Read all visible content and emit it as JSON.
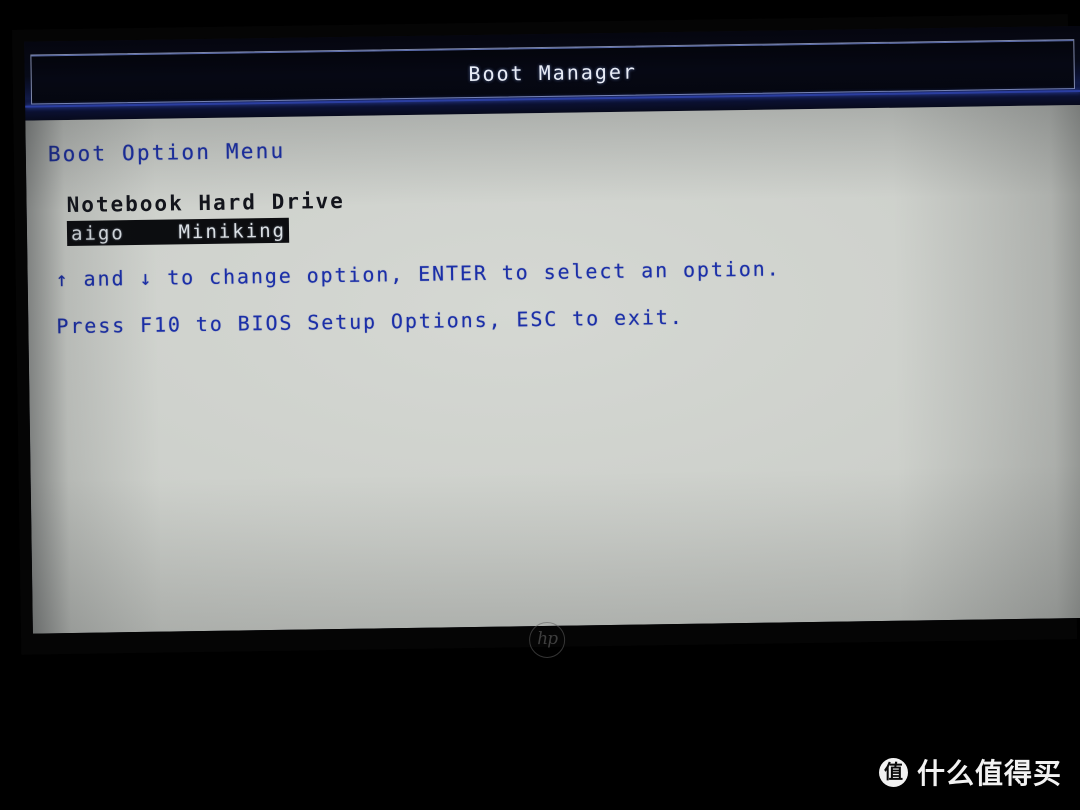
{
  "screen": {
    "title": "Boot Manager",
    "section_heading": "Boot Option Menu",
    "groups": [
      {
        "label": "Notebook Hard Drive",
        "items": [
          {
            "label": "aigo    Miniking",
            "selected": true
          }
        ]
      }
    ],
    "hints": [
      "↑ and ↓ to change option, ENTER to select an option.",
      "Press F10 to BIOS Setup Options, ESC to exit."
    ],
    "colors": {
      "titlebar_bg": "#05060f",
      "titlebar_border": "#7e87a8",
      "title_text": "#e8ecf6",
      "body_bg": "#cdd0cb",
      "hint_blue": "#1b2fa8",
      "heading_dark": "#13151c",
      "highlight_bg": "#0c0d10",
      "highlight_text": "#dadfe4"
    }
  },
  "bezel": {
    "brand_logo": "hp"
  },
  "watermark": {
    "badge": "值",
    "text": "什么值得买"
  }
}
